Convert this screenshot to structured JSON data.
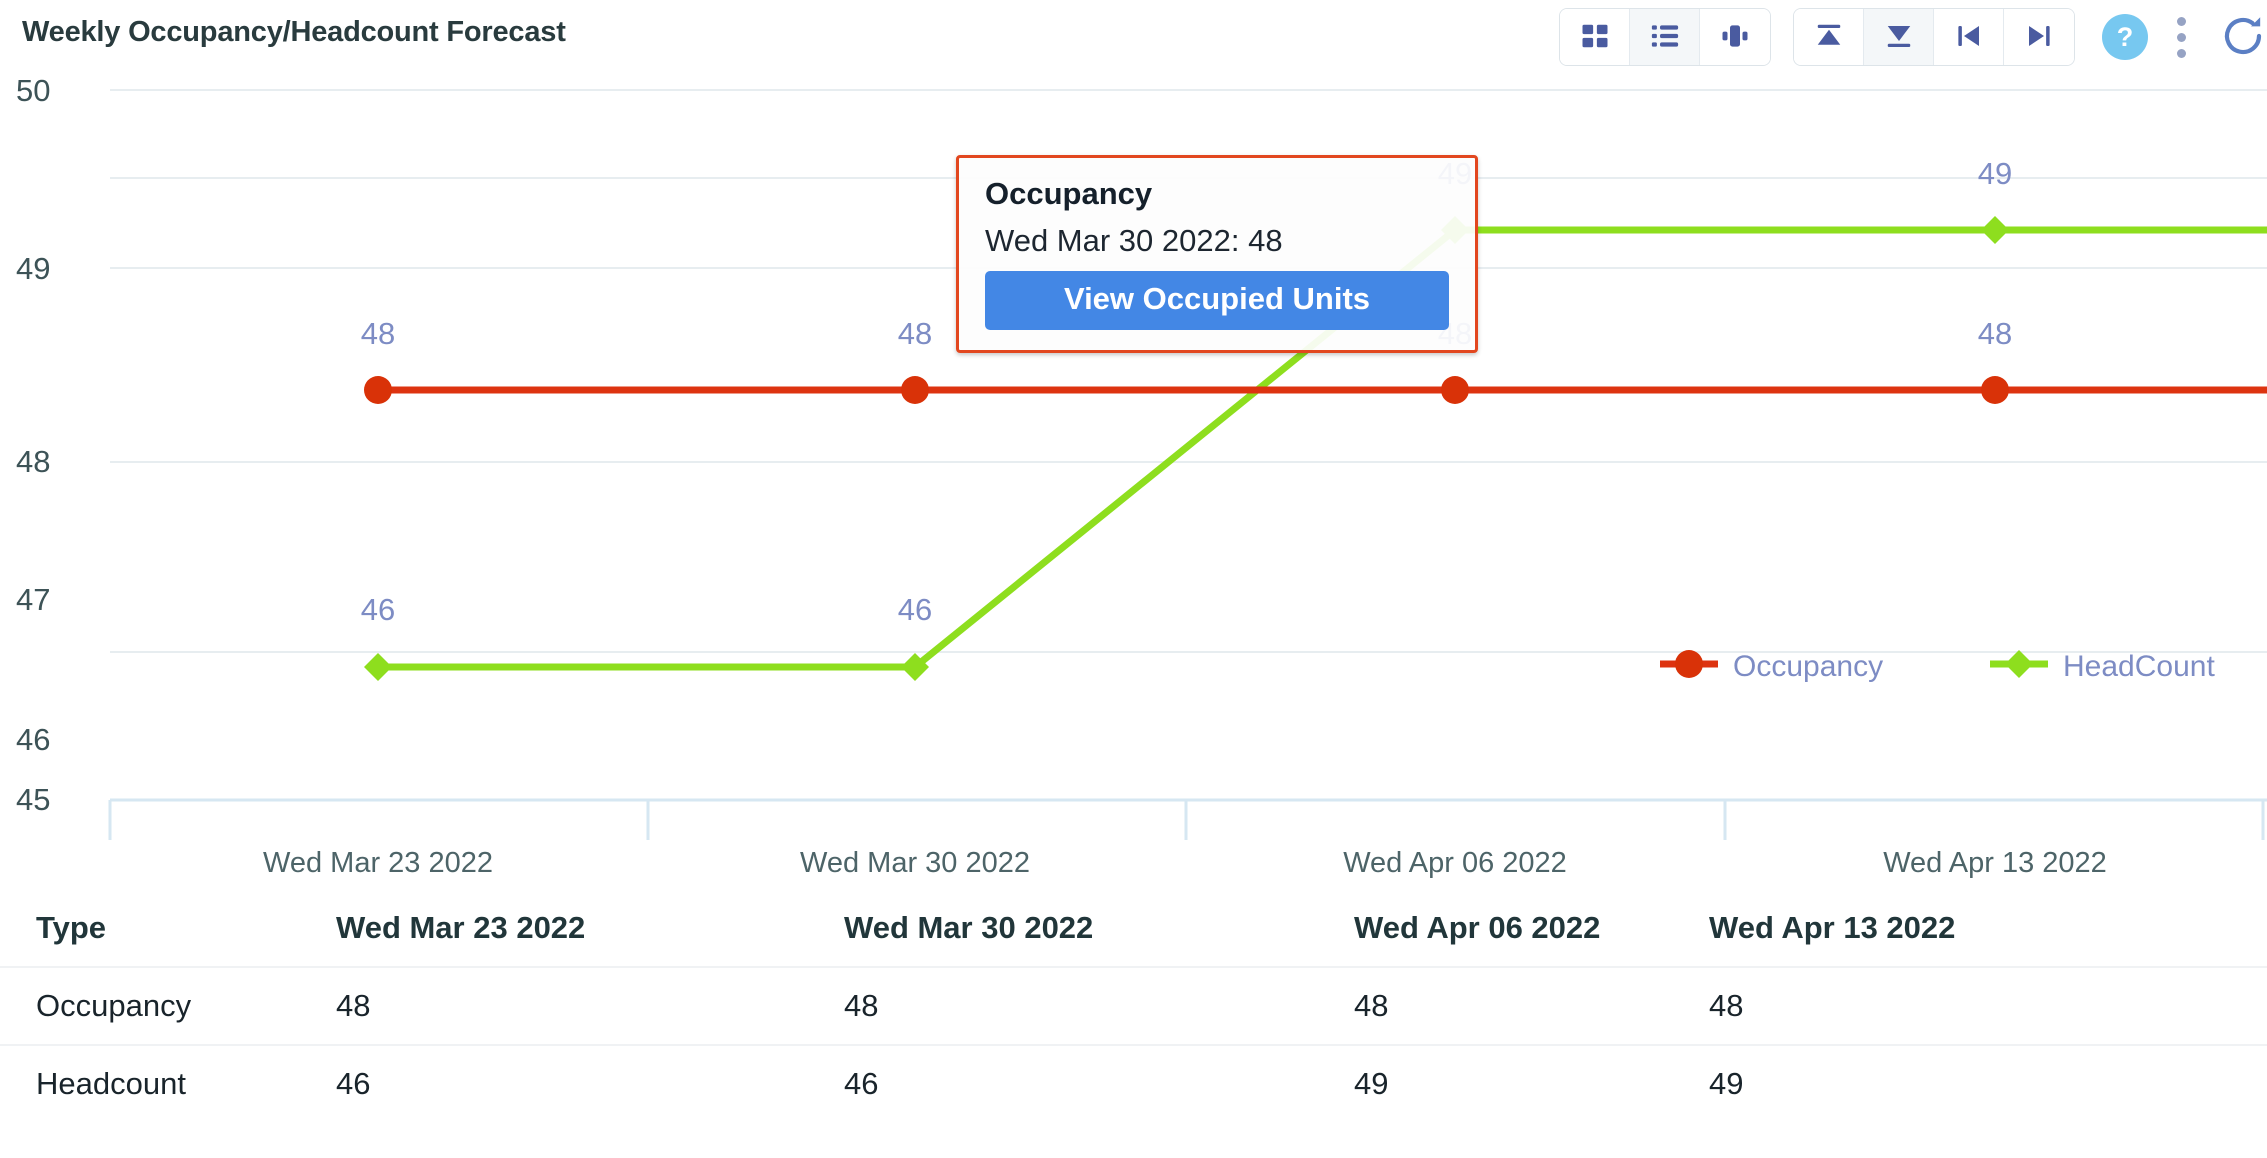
{
  "header": {
    "title": "Weekly Occupancy/Headcount Forecast",
    "toolbar": {
      "group_view": [
        {
          "name": "grid-view-button",
          "icon": "grid-icon",
          "active": false
        },
        {
          "name": "list-view-button",
          "icon": "list-icon",
          "active": true
        },
        {
          "name": "chart-view-button",
          "icon": "bar-chart-icon",
          "active": false
        }
      ],
      "group_nav": [
        {
          "name": "collapse-top-button",
          "icon": "collapse-up-icon",
          "active": false
        },
        {
          "name": "collapse-bottom-button",
          "icon": "collapse-down-icon",
          "active": true
        },
        {
          "name": "first-page-button",
          "icon": "skip-first-icon",
          "active": false
        },
        {
          "name": "last-page-button",
          "icon": "skip-last-icon",
          "active": false
        }
      ],
      "help_label": "?",
      "more_label": "",
      "refresh_label": ""
    }
  },
  "tooltip": {
    "title": "Occupancy",
    "row": "Wed Mar 30 2022: 48",
    "button_label": "View Occupied Units",
    "border_color": "#e2471f",
    "button_color": "#4387e5"
  },
  "legend": [
    {
      "label": "Occupancy",
      "color": "#dd3310",
      "marker": "circle"
    },
    {
      "label": "HeadCount",
      "color": "#8ede1e",
      "marker": "diamond"
    }
  ],
  "table": {
    "columns": [
      "Type",
      "Wed Mar 23 2022",
      "Wed Mar 30 2022",
      "Wed Apr 06 2022",
      "Wed Apr 13 2022"
    ],
    "rows": [
      {
        "type": "Occupancy",
        "values": [
          "48",
          "48",
          "48",
          "48"
        ]
      },
      {
        "type": "Headcount",
        "values": [
          "46",
          "46",
          "49",
          "49"
        ]
      }
    ]
  },
  "chart_data": {
    "type": "line",
    "title": "Weekly Occupancy/Headcount Forecast",
    "xlabel": "",
    "ylabel": "",
    "categories": [
      "Wed Mar 23 2022",
      "Wed Mar 30 2022",
      "Wed Apr 06 2022",
      "Wed Apr 13 2022"
    ],
    "series": [
      {
        "name": "Occupancy",
        "color": "#dd3310",
        "marker": "circle",
        "values": [
          48,
          48,
          48,
          48
        ]
      },
      {
        "name": "HeadCount",
        "color": "#8ede1e",
        "marker": "diamond",
        "values": [
          46,
          46,
          49,
          49
        ]
      }
    ],
    "yticks": [
      50,
      49,
      48,
      47,
      46,
      45
    ],
    "ylim": [
      45,
      50
    ],
    "grid": true,
    "legend_position": "right",
    "data_labels": true,
    "data_label_color": "#7d8cc4"
  }
}
